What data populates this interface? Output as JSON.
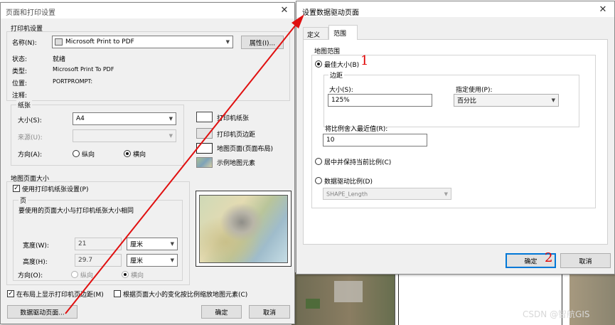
{
  "left_dialog": {
    "title": "页面和打印设置",
    "printer_group": "打印机设置",
    "name_label": "名称(N):",
    "printer_name": "Microsoft Print to PDF",
    "properties_button": "属性(I)...",
    "status_label": "状态:",
    "status_value": "就绪",
    "type_label": "类型:",
    "type_value": "Microsoft Print To PDF",
    "where_label": "位置:",
    "where_value": "PORTPROMPT:",
    "comment_label": "注释:",
    "paper_group": "纸张",
    "size_label": "大小(S):",
    "size_value": "A4",
    "source_label": "来源(U):",
    "orientation_label": "方向(A):",
    "portrait": "纵向",
    "landscape": "横向",
    "legend": {
      "printer_paper": "打印机纸张",
      "printer_margins": "打印机页边距",
      "map_page": "地图页面(页面布局)",
      "sample_elements": "示例地图元素"
    },
    "map_page_size_group": "地图页面大小",
    "use_printer_paper": "使用打印机纸张设置(P)",
    "page_group": "页",
    "page_note": "要使用的页面大小与打印机纸张大小相同",
    "width_label": "宽度(W):",
    "width_value": "21",
    "height_label": "高度(H):",
    "height_value": "29.7",
    "unit": "厘米",
    "orientation_label2": "方向(O):",
    "show_margins": "在布局上显示打印机页边距(M)",
    "scale_elements": "根据页面大小的变化按比例缩放地图元素(C)",
    "data_driven_button": "数据驱动页面...",
    "ok_button": "确定",
    "cancel_button": "取消"
  },
  "right_dialog": {
    "title": "设置数据驱动页面",
    "tabs": [
      "定义",
      "范围"
    ],
    "extent_group": "地图范围",
    "best_fit": "最佳大小(B)",
    "annotation_1": "1",
    "margin_group": "边距",
    "margin_size_label": "大小(S):",
    "margin_size_value": "125%",
    "specify_label": "指定使用(P):",
    "specify_value": "百分比",
    "round_label": "将比例舍入最近值(R):",
    "round_value": "10",
    "center_keep": "居中并保持当前比例(C)",
    "data_driven_scale": "数据驱动比例(D)",
    "scale_field": "SHAPE_Length",
    "ok_button": "确定",
    "annotation_2": "2",
    "cancel_button": "取消"
  },
  "watermark": "CSDN @智航GIS",
  "colors": {
    "annotation": "#e00000",
    "arrow": "#e01010",
    "accent": "#0078d7"
  }
}
